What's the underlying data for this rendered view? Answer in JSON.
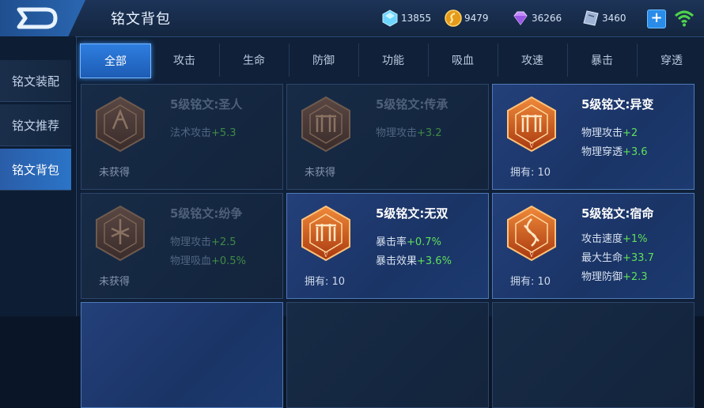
{
  "header": {
    "title": "铭文背包",
    "resources": [
      {
        "icon": "crystal-icon",
        "value": "13855"
      },
      {
        "icon": "gold-coin-icon",
        "value": "9479"
      },
      {
        "icon": "diamond-icon",
        "value": "36266"
      },
      {
        "icon": "ticket-icon",
        "value": "3460"
      }
    ],
    "plus_label": "+"
  },
  "sidebar": {
    "items": [
      {
        "label": "铭文装配"
      },
      {
        "label": "铭文推荐"
      },
      {
        "label": "铭文背包"
      }
    ],
    "active_index": 2
  },
  "tabs": [
    {
      "label": "全部"
    },
    {
      "label": "攻击"
    },
    {
      "label": "生命"
    },
    {
      "label": "防御"
    },
    {
      "label": "功能"
    },
    {
      "label": "吸血"
    },
    {
      "label": "攻速"
    },
    {
      "label": "暴击"
    },
    {
      "label": "穿透"
    }
  ],
  "cards": [
    {
      "name": "5级铭文:圣人",
      "state": "locked",
      "stats": [
        {
          "label": "法术攻击",
          "value": "+5.3"
        }
      ],
      "footer": "未获得"
    },
    {
      "name": "5级铭文:传承",
      "state": "locked",
      "stats": [
        {
          "label": "物理攻击",
          "value": "+3.2"
        }
      ],
      "footer": "未获得"
    },
    {
      "name": "5级铭文:异变",
      "state": "owned",
      "stats": [
        {
          "label": "物理攻击",
          "value": "+2"
        },
        {
          "label": "物理穿透",
          "value": "+3.6"
        }
      ],
      "footer": "拥有: 10"
    },
    {
      "name": "5级铭文:纷争",
      "state": "locked",
      "stats": [
        {
          "label": "物理攻击",
          "value": "+2.5"
        },
        {
          "label": "物理吸血",
          "value": "+0.5%"
        }
      ],
      "footer": "未获得"
    },
    {
      "name": "5级铭文:无双",
      "state": "owned",
      "stats": [
        {
          "label": "暴击率",
          "value": "+0.7%"
        },
        {
          "label": "暴击效果",
          "value": "+3.6%"
        }
      ],
      "footer": "拥有: 10"
    },
    {
      "name": "5级铭文:宿命",
      "state": "owned",
      "stats": [
        {
          "label": "攻击速度",
          "value": "+1%"
        },
        {
          "label": "最大生命",
          "value": "+33.7"
        },
        {
          "label": "物理防御",
          "value": "+2.3"
        }
      ],
      "footer": "拥有: 10"
    }
  ],
  "colors": {
    "accent": "#2e7ee0",
    "stat_value": "#5fe05a",
    "rune_owned": "#c8561e",
    "rune_locked": "#4a3a36"
  }
}
